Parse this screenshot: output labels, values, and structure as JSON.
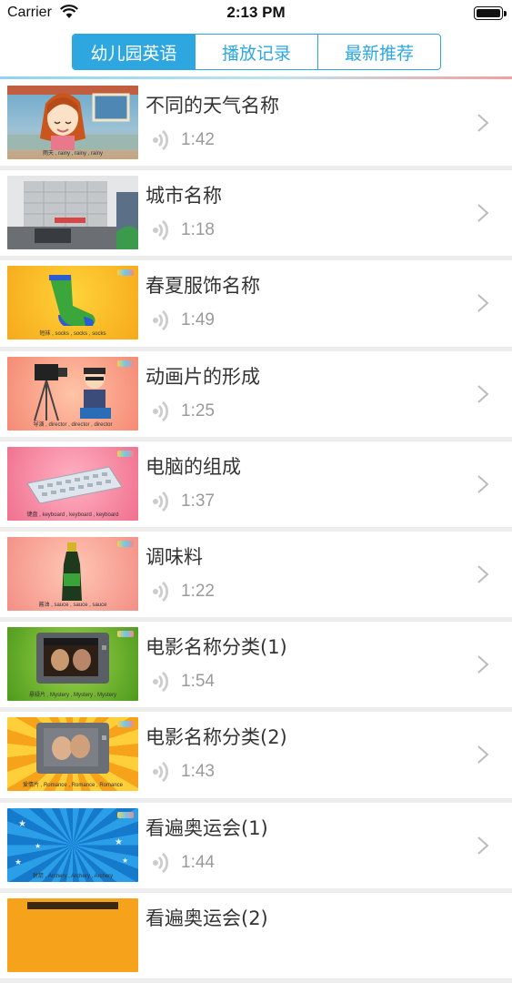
{
  "status": {
    "carrier": "Carrier",
    "time": "2:13 PM",
    "battery_level": 1.0
  },
  "tabs": [
    {
      "label": "幼儿园英语",
      "active": true
    },
    {
      "label": "播放记录",
      "active": false
    },
    {
      "label": "最新推荐",
      "active": false
    }
  ],
  "colors": {
    "accent": "#2ea7e0",
    "duration": "#9a9a9a",
    "separator": "#ededed"
  },
  "items": [
    {
      "title": "不同的天气名称",
      "duration": "1:42",
      "caption": "雨天 , rainy , rainy , rainy",
      "thumb_icon": "girl-rain-icon"
    },
    {
      "title": "城市名称",
      "duration": "1:18",
      "caption": "",
      "thumb_icon": "building-icon"
    },
    {
      "title": "春夏服饰名称",
      "duration": "1:49",
      "caption": "短袜 , socks , socks , socks",
      "thumb_icon": "sock-icon"
    },
    {
      "title": "动画片的形成",
      "duration": "1:25",
      "caption": "导演 , director , director , director",
      "thumb_icon": "camera-icon"
    },
    {
      "title": "电脑的组成",
      "duration": "1:37",
      "caption": "键盘 , keyboard , keyboard , keyboard",
      "thumb_icon": "keyboard-icon"
    },
    {
      "title": "调味料",
      "duration": "1:22",
      "caption": "酱油 , sauce , sauce , sauce",
      "thumb_icon": "bottle-icon"
    },
    {
      "title": "电影名称分类(1)",
      "duration": "1:54",
      "caption": "悬疑片 , Mystery , Mystery , Mystery",
      "thumb_icon": "tv-icon"
    },
    {
      "title": "电影名称分类(2)",
      "duration": "1:43",
      "caption": "爱情片 , Romance , Romance , Romance",
      "thumb_icon": "tv-icon"
    },
    {
      "title": "看遍奥运会(1)",
      "duration": "1:44",
      "caption": "射箭 , Archery , Archery , Archery",
      "thumb_icon": "stars-icon"
    },
    {
      "title": "看遍奥运会(2)",
      "duration": "",
      "caption": "",
      "thumb_icon": "sign-icon"
    }
  ]
}
